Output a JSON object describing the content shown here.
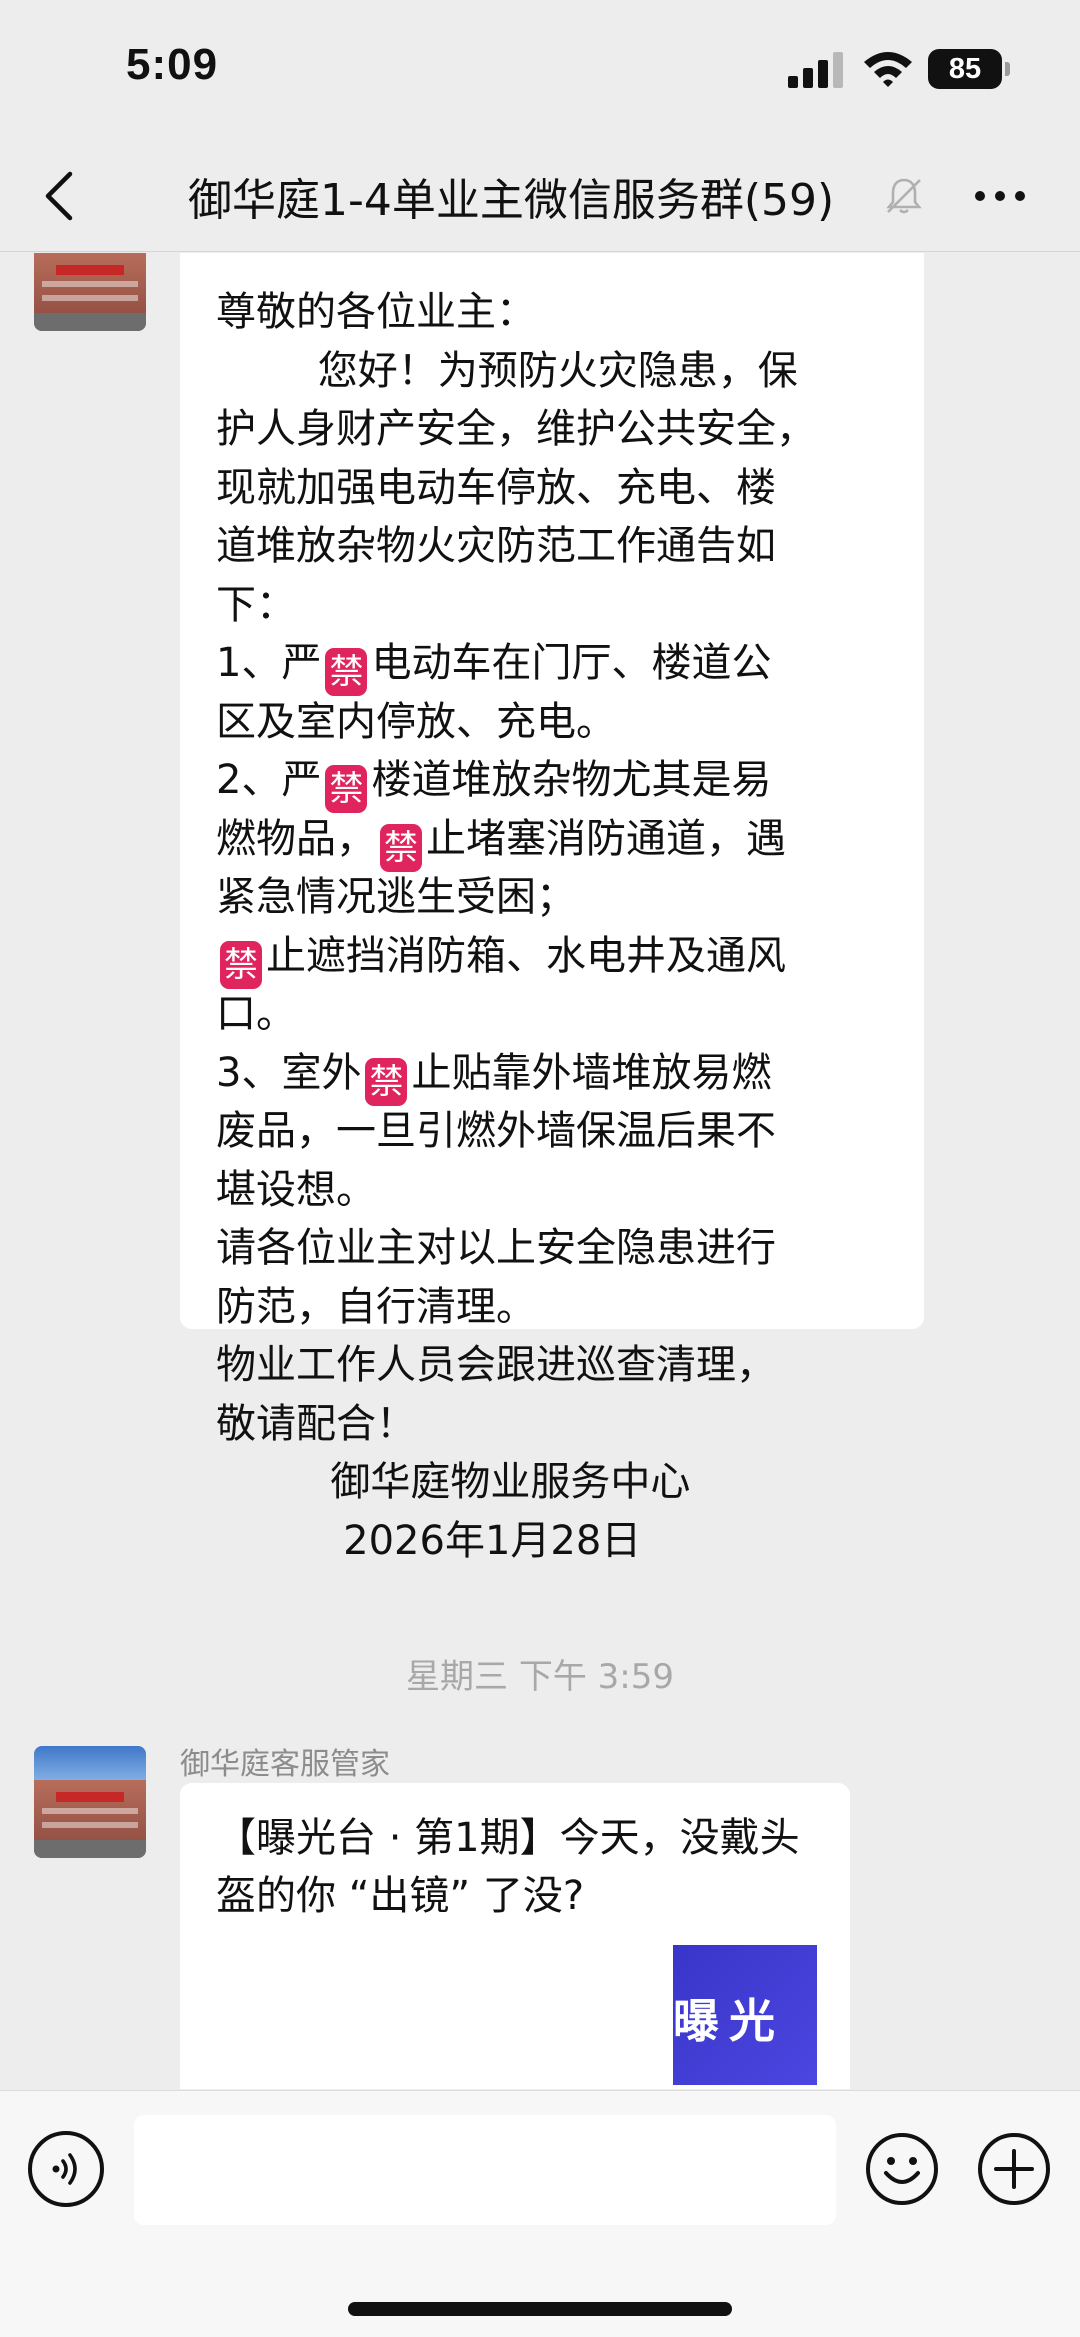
{
  "status_bar": {
    "time": "5:09",
    "battery": "85"
  },
  "nav": {
    "title": "御华庭1-4单业主微信服务群(59)"
  },
  "messages": {
    "notice": {
      "lines": [
        "尊敬的各位业主：",
        "        您好！为预防火灾隐患，保",
        "护人身财产安全，维护公共安全，",
        "现就加强电动车停放、充电、楼",
        "道堆放杂物火灾防范工作通告如",
        "下：",
        "1、严🈲电动车在门厅、楼道公",
        "区及室内停放、充电。",
        "2、严🈲楼道堆放杂物尤其是易",
        "燃物品，🈲止堵塞消防通道，遇",
        "紧急情况逃生受困；",
        "🈲止遮挡消防箱、水电井及通风",
        "口。",
        "3、室外🈲止贴靠外墙堆放易燃",
        "废品，一旦引燃外墙保温后果不",
        "堪设想。",
        "请各位业主对以上安全隐患进行",
        "防范，自行清理。",
        "物业工作人员会跟进巡查清理，",
        "敬请配合！",
        "         御华庭物业服务中心",
        "          2026年1月28日"
      ]
    },
    "timestamp": "星期三 下午 3:59",
    "second": {
      "sender": "御华庭客服管家",
      "text": "【曝光台 · 第1期】今天，没戴头盔的你 “出镜” 了没?",
      "preview_text": "曝光"
    }
  },
  "colors": {
    "background": "#ededed",
    "bubble": "#ffffff",
    "ban_badge": "#e0245e",
    "preview": "#3a35c9"
  },
  "icons": [
    "back-icon",
    "mute-icon",
    "more-icon",
    "voice-icon",
    "emoji-icon",
    "plus-icon"
  ]
}
